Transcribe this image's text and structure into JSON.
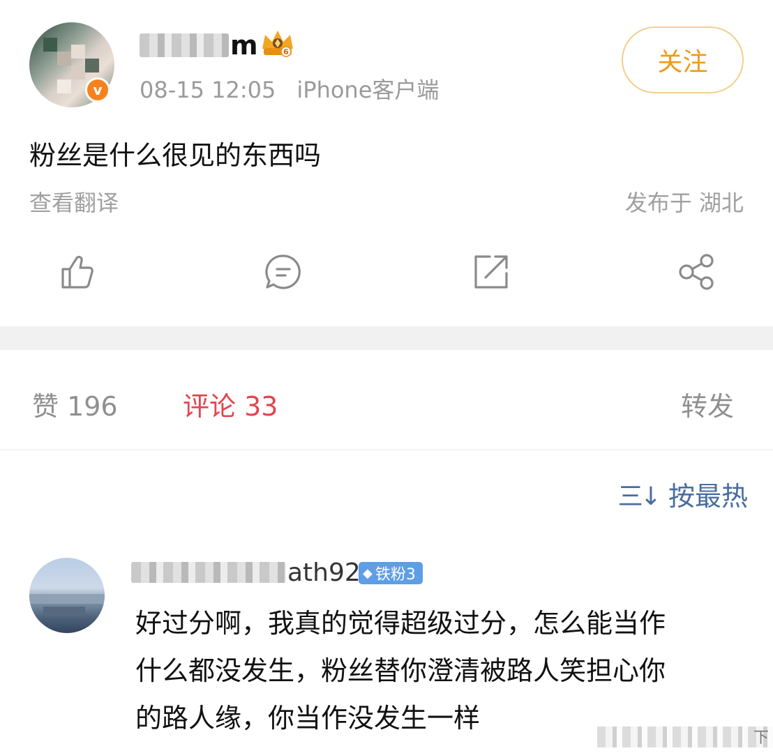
{
  "post": {
    "username_visible": "m",
    "time": "08-15 12:05",
    "client": "iPhone客户端",
    "follow_label": "关注",
    "text": "粉丝是什么很见的东西吗",
    "translate_label": "查看翻译",
    "location": "发布于 湖北",
    "icons": {
      "like": "thumbs-up-icon",
      "comment": "comment-icon",
      "repost": "repost-icon",
      "share": "share-icon",
      "verified": "verified-v-badge",
      "crown": "crown-level-icon"
    },
    "verified_glyph": "v",
    "crown_level": "6"
  },
  "tabs": {
    "likes": "赞 196",
    "comments": "评论 33",
    "reposts": "转发"
  },
  "sort": {
    "icon": "sort-icon",
    "glyph": "三",
    "glyph2": "↓",
    "label": "按最热"
  },
  "comment": {
    "username_visible": "ath923",
    "badge": "铁粉3",
    "badge_icon": "diamond-icon",
    "lines": [
      "好过分啊，我真的觉得超级过分，怎么能当作",
      "什么都没发生，粉丝替你澄清被路人笑担心你",
      "的路人缘，你当作没发生一样"
    ]
  },
  "footer": {
    "glyph": "下"
  },
  "colors": {
    "accent_orange": "#ef9a17",
    "active_tab_red": "#e0464e",
    "link_blue": "#4a6da0",
    "muted_gray": "#9a9a9a",
    "fan_badge_blue": "#5d9ee6"
  }
}
